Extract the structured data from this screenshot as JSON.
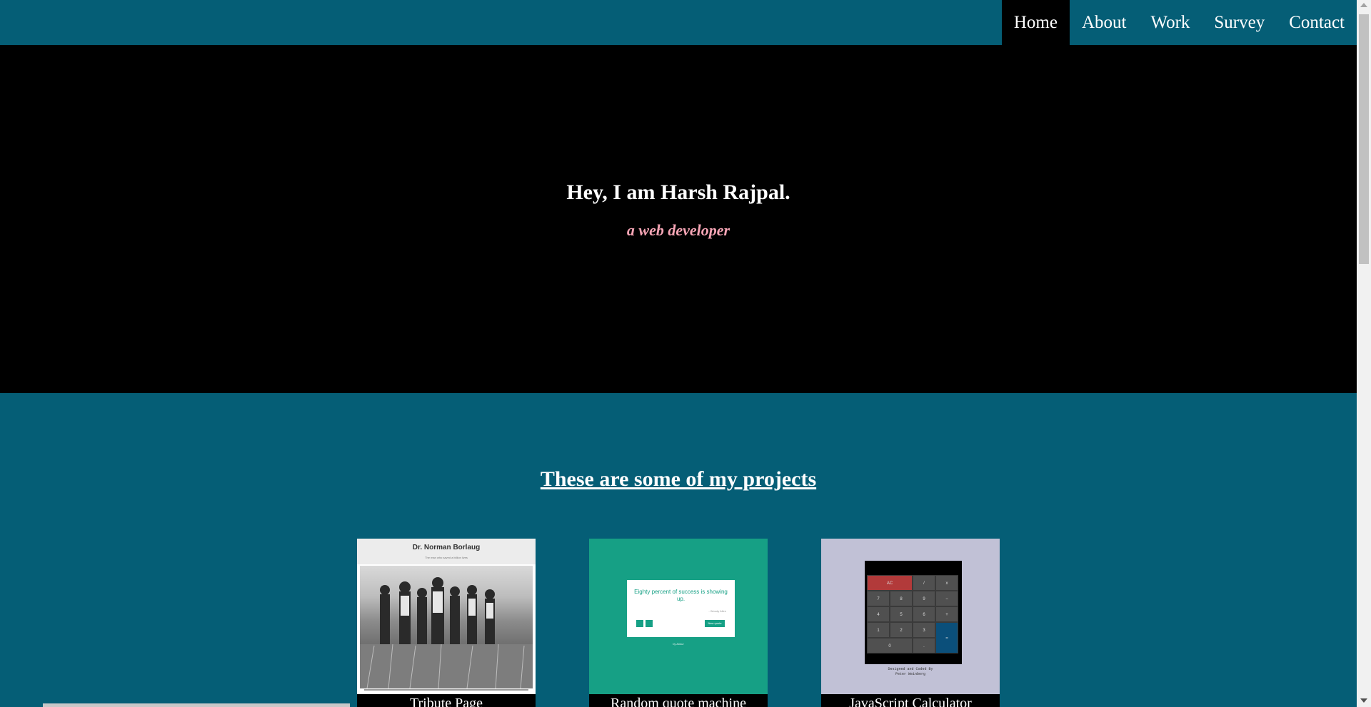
{
  "nav": {
    "items": [
      {
        "label": "Home",
        "active": true
      },
      {
        "label": "About",
        "active": false
      },
      {
        "label": "Work",
        "active": false
      },
      {
        "label": "Survey",
        "active": false
      },
      {
        "label": "Contact",
        "active": false
      }
    ]
  },
  "hero": {
    "title": "Hey, I am Harsh Rajpal.",
    "subtitle": "a web developer"
  },
  "projects": {
    "title": "These are some of my projects",
    "items": [
      {
        "caption": "Tribute Page",
        "thumb_title": "Dr. Norman Borlaug",
        "thumb_subtitle": "The man who saved a billion lives"
      },
      {
        "caption": "Random quote machine",
        "thumb_quote": "Eighty percent of success is showing up.",
        "thumb_author": "- Woody Allen",
        "thumb_button": "New quote",
        "thumb_by": "by Ankur"
      },
      {
        "caption": "JavaScript Calculator",
        "thumb_keys": [
          "AC",
          "/",
          "x",
          "7",
          "8",
          "9",
          "−",
          "4",
          "5",
          "6",
          "+",
          "1",
          "2",
          "3",
          "=",
          "0",
          "."
        ],
        "thumb_credit": "Designed and Coded By\nPeter Weinberg"
      }
    ]
  },
  "colors": {
    "nav_bg": "#055e76",
    "hero_bg": "#000000",
    "accent_pink": "#f6a5b5",
    "section_bg": "#055e76"
  }
}
